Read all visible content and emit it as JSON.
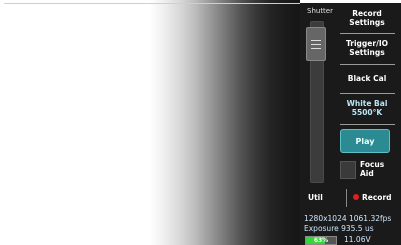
{
  "panel": {
    "shutter_label": "Shutter",
    "buttons": {
      "record_settings": [
        "Record",
        "Settings"
      ],
      "trigger_io": [
        "Trigger/IO",
        "Settings"
      ],
      "black_cal": "Black Cal",
      "white_bal": [
        "White Bal",
        "5500°K"
      ],
      "play": "Play",
      "focus_aid": [
        "Focus",
        "Aid"
      ],
      "util": "Util",
      "record": "Record"
    },
    "focus_aid_checked": false,
    "shutter_slider_level": 0.05
  },
  "status": {
    "resolution_fps": "1280x1024 1061.32fps",
    "exposure": "Exposure 935.5 us",
    "battery_percent": "63%",
    "battery_level": 0.63,
    "voltage": "11.06V"
  },
  "colors": {
    "panel_bg": "#1a1a1a",
    "play_bg": "#2c8a92",
    "record_dot": "#e02020",
    "battery_fill": "#34d63a"
  }
}
